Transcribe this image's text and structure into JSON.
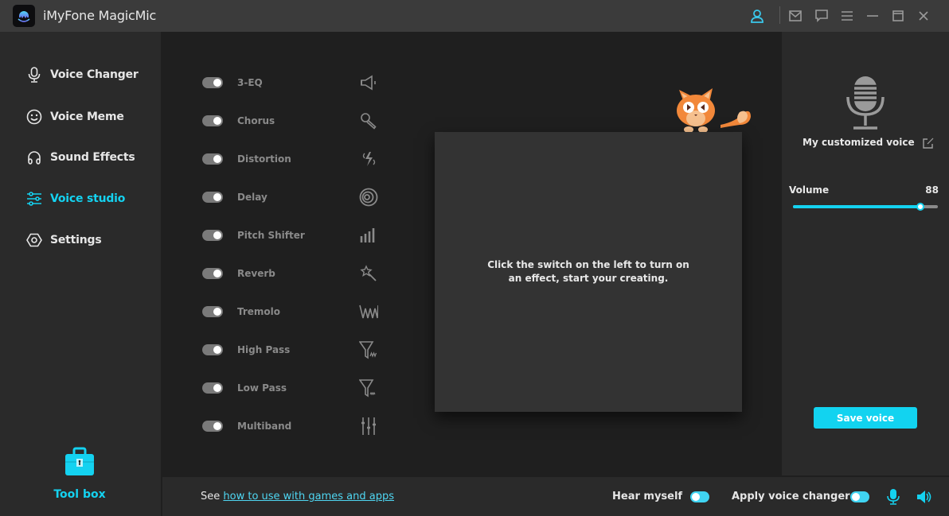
{
  "app": {
    "title": "iMyFone MagicMic",
    "logo_icon": "magicmic-logo",
    "titlebar_icons": [
      "user-icon",
      "mail-icon",
      "chat-icon",
      "menu-icon",
      "minimize-icon",
      "maximize-icon",
      "close-icon"
    ]
  },
  "sidebar": {
    "items": [
      {
        "label": "Voice Changer",
        "icon": "microphone-icon",
        "active": false
      },
      {
        "label": "Voice Meme",
        "icon": "smiley-icon",
        "active": false
      },
      {
        "label": "Sound Effects",
        "icon": "headphones-icon",
        "active": false
      },
      {
        "label": "Voice studio",
        "icon": "sliders-icon",
        "active": true
      },
      {
        "label": "Settings",
        "icon": "settings-hexagon-icon",
        "active": false
      }
    ],
    "toolbox": {
      "label": "Tool box",
      "icon": "toolbox-icon"
    }
  },
  "effects": [
    {
      "label": "3-EQ",
      "icon": "speaker-icon",
      "enabled": false
    },
    {
      "label": "Chorus",
      "icon": "microphone-handheld-icon",
      "enabled": false
    },
    {
      "label": "Distortion",
      "icon": "lightning-waves-icon",
      "enabled": false
    },
    {
      "label": "Delay",
      "icon": "concentric-circles-icon",
      "enabled": false
    },
    {
      "label": "Pitch Shifter",
      "icon": "bars-ascending-icon",
      "enabled": false
    },
    {
      "label": "Reverb",
      "icon": "magic-wand-icon",
      "enabled": false
    },
    {
      "label": "Tremolo",
      "icon": "zigzag-wave-icon",
      "enabled": false
    },
    {
      "label": "High Pass",
      "icon": "filter-high-icon",
      "enabled": false
    },
    {
      "label": "Low Pass",
      "icon": "filter-low-icon",
      "enabled": false
    },
    {
      "label": "Multiband",
      "icon": "equalizer-sliders-icon",
      "enabled": false
    }
  ],
  "center": {
    "message": "Click the switch on the left to turn on an effect, start your creating.",
    "mascot": "orange-cat-mascot"
  },
  "right_panel": {
    "voice_name": "My customized voice",
    "voice_icon": "studio-microphone-icon",
    "volume_label": "Volume",
    "volume_value": "88",
    "volume_fraction": 0.88,
    "save_label": "Save voice"
  },
  "bottom_bar": {
    "see_prefix": "See",
    "link_text": "how to use with games and apps",
    "hear_myself_label": "Hear myself",
    "hear_myself_on": true,
    "apply_label": "Apply voice changer",
    "apply_on": true
  },
  "colors": {
    "accent": "#14d2f0",
    "titlebar": "#3b3b3b",
    "sidebar": "#2a2a2a",
    "main_bg": "#1f1f1f",
    "card": "#333333"
  }
}
